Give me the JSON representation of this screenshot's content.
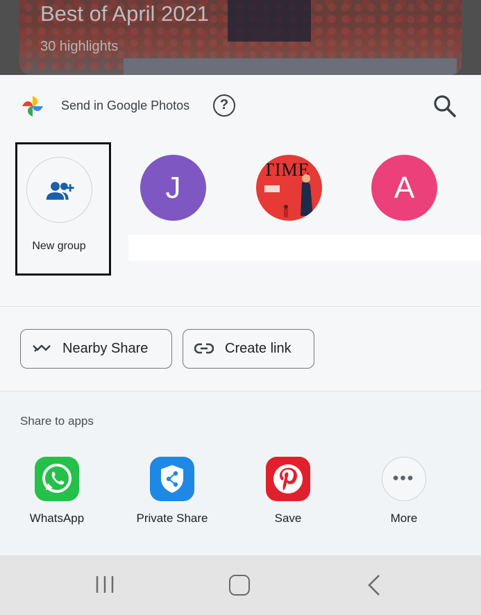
{
  "background": {
    "title": "Best of April 2021",
    "subtitle": "30 highlights"
  },
  "header": {
    "send_in_label": "Send in Google Photos",
    "help_icon": "question-circle-icon",
    "search_icon": "search-icon"
  },
  "contacts": {
    "new_group_label": "New group",
    "avatars": [
      {
        "initial": "J",
        "color": "#7e57c2"
      },
      {
        "initial": "TIME",
        "color": "#e53a35"
      },
      {
        "initial": "A",
        "color": "#ec407a"
      }
    ]
  },
  "actions": {
    "nearby_share": "Nearby Share",
    "create_link": "Create link"
  },
  "share_to_apps": {
    "label": "Share to apps",
    "apps": [
      {
        "label": "WhatsApp",
        "color": "#25c04a"
      },
      {
        "label": "Private Share",
        "color": "#1e88e5"
      },
      {
        "label": "Save",
        "color": "#e0212d"
      },
      {
        "label": "More",
        "color": "#ffffff"
      }
    ]
  },
  "navbar": {
    "recents": "recents-icon",
    "home": "home-icon",
    "back": "back-icon"
  }
}
